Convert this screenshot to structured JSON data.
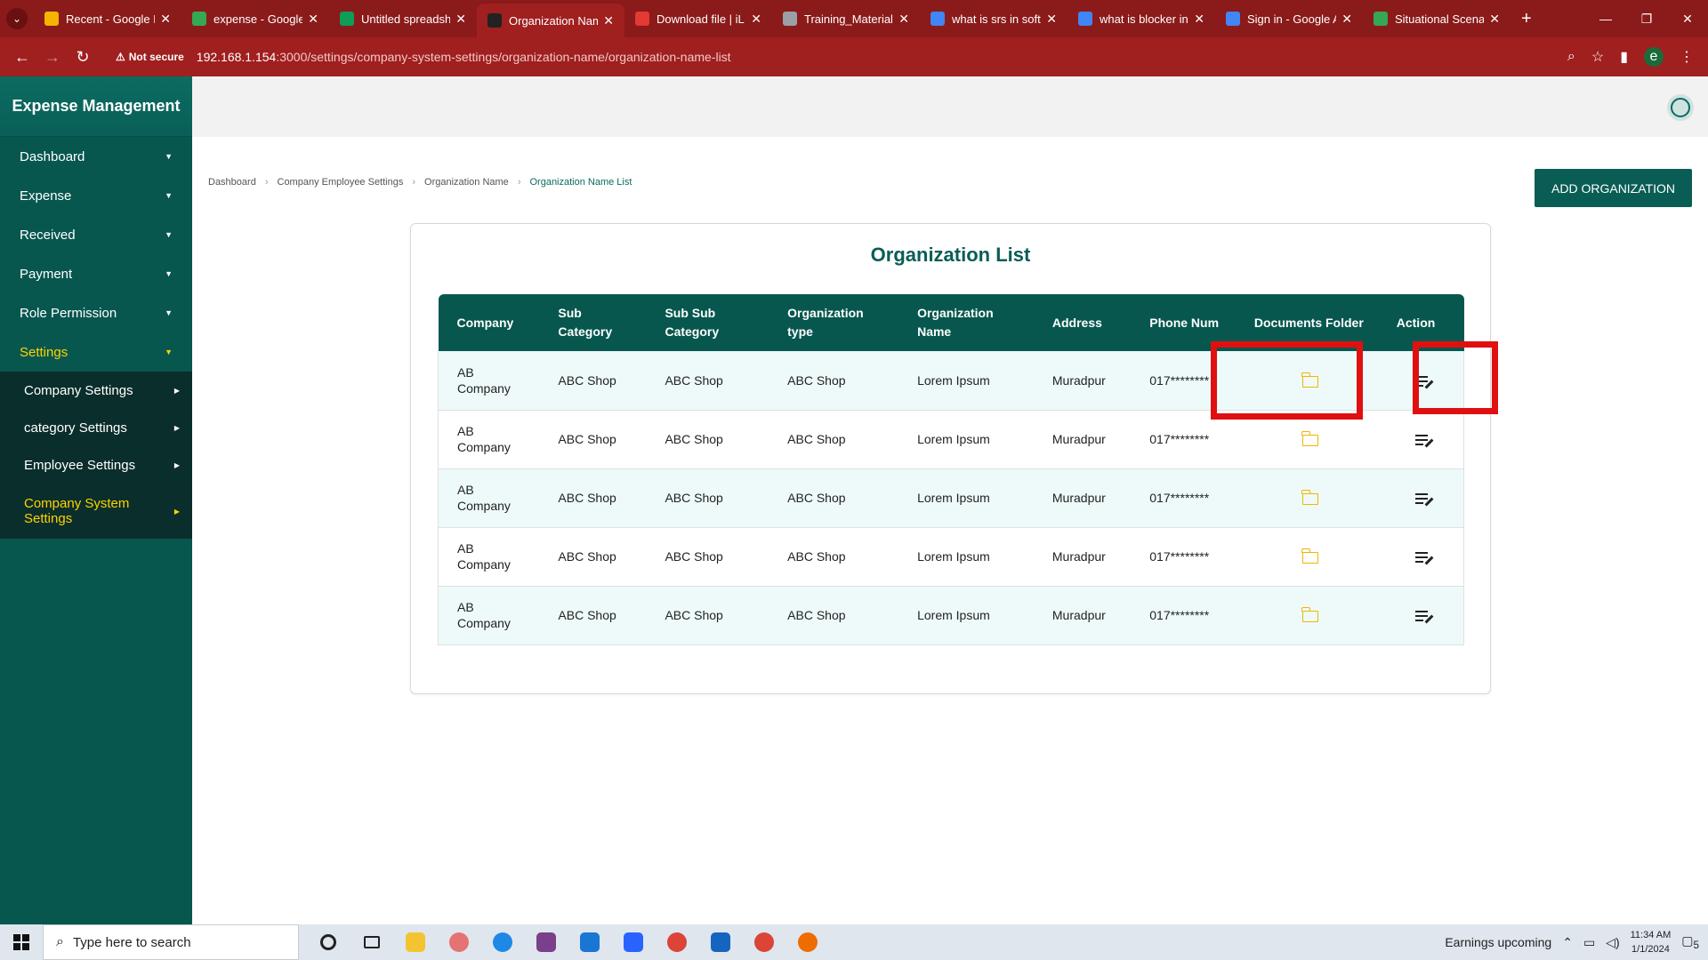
{
  "browser": {
    "tabs": [
      {
        "title": "Recent - Google D",
        "color": "#f4b400"
      },
      {
        "title": "expense - Google",
        "color": "#34a853"
      },
      {
        "title": "Untitled spreadsh",
        "color": "#0f9d58"
      },
      {
        "title": "Organization Nam",
        "color": "#222222",
        "active": true
      },
      {
        "title": "Download file | iL",
        "color": "#e53935"
      },
      {
        "title": "Training_Materials",
        "color": "#9aa0a6"
      },
      {
        "title": "what is srs in softw",
        "color": "#4285f4"
      },
      {
        "title": "what is blocker in",
        "color": "#4285f4"
      },
      {
        "title": "Sign in - Google A",
        "color": "#4285f4"
      },
      {
        "title": "Situational Scena",
        "color": "#34a853"
      }
    ],
    "security_label": "Not secure",
    "url_host": "192.168.1.154",
    "url_rest": ":3000/settings/company-system-settings/organization-name/organization-name-list",
    "profile_initial": "e"
  },
  "sidebar": {
    "brand": "Expense Management",
    "items": [
      {
        "label": "Dashboard"
      },
      {
        "label": "Expense"
      },
      {
        "label": "Received"
      },
      {
        "label": "Payment"
      },
      {
        "label": "Role Permission"
      },
      {
        "label": "Settings",
        "active": true
      }
    ],
    "sub_items": [
      {
        "label": "Company Settings"
      },
      {
        "label": "category Settings"
      },
      {
        "label": "Employee Settings"
      },
      {
        "label": "Company System Settings",
        "active": true
      }
    ]
  },
  "breadcrumb": [
    "Dashboard",
    "Company Employee Settings",
    "Organization Name",
    "Organization Name List"
  ],
  "add_button_label": "ADD ORGANIZATION",
  "card_title": "Organization List",
  "table": {
    "headers": [
      "Company",
      "Sub Category",
      "Sub Sub Category",
      "Organization type",
      "Organization Name",
      "Address",
      "Phone Num",
      "Documents Folder",
      "Action"
    ],
    "rows": [
      [
        "AB Company",
        "ABC Shop",
        "ABC Shop",
        "ABC Shop",
        "Lorem Ipsum",
        "Muradpur",
        "017********"
      ],
      [
        "AB Company",
        "ABC Shop",
        "ABC Shop",
        "ABC Shop",
        "Lorem Ipsum",
        "Muradpur",
        "017********"
      ],
      [
        "AB Company",
        "ABC Shop",
        "ABC Shop",
        "ABC Shop",
        "Lorem Ipsum",
        "Muradpur",
        "017********"
      ],
      [
        "AB Company",
        "ABC Shop",
        "ABC Shop",
        "ABC Shop",
        "Lorem Ipsum",
        "Muradpur",
        "017********"
      ],
      [
        "AB Company",
        "ABC Shop",
        "ABC Shop",
        "ABC Shop",
        "Lorem Ipsum",
        "Muradpur",
        "017********"
      ]
    ]
  },
  "taskbar": {
    "search_placeholder": "Type here to search",
    "news": "Earnings upcoming",
    "time": "11:34 AM",
    "date": "1/1/2024",
    "notification_count": "5"
  },
  "colors": {
    "primary": "#07574f",
    "accent": "#ffd200",
    "folder": "#f1b400",
    "highlight": "#e01010"
  }
}
